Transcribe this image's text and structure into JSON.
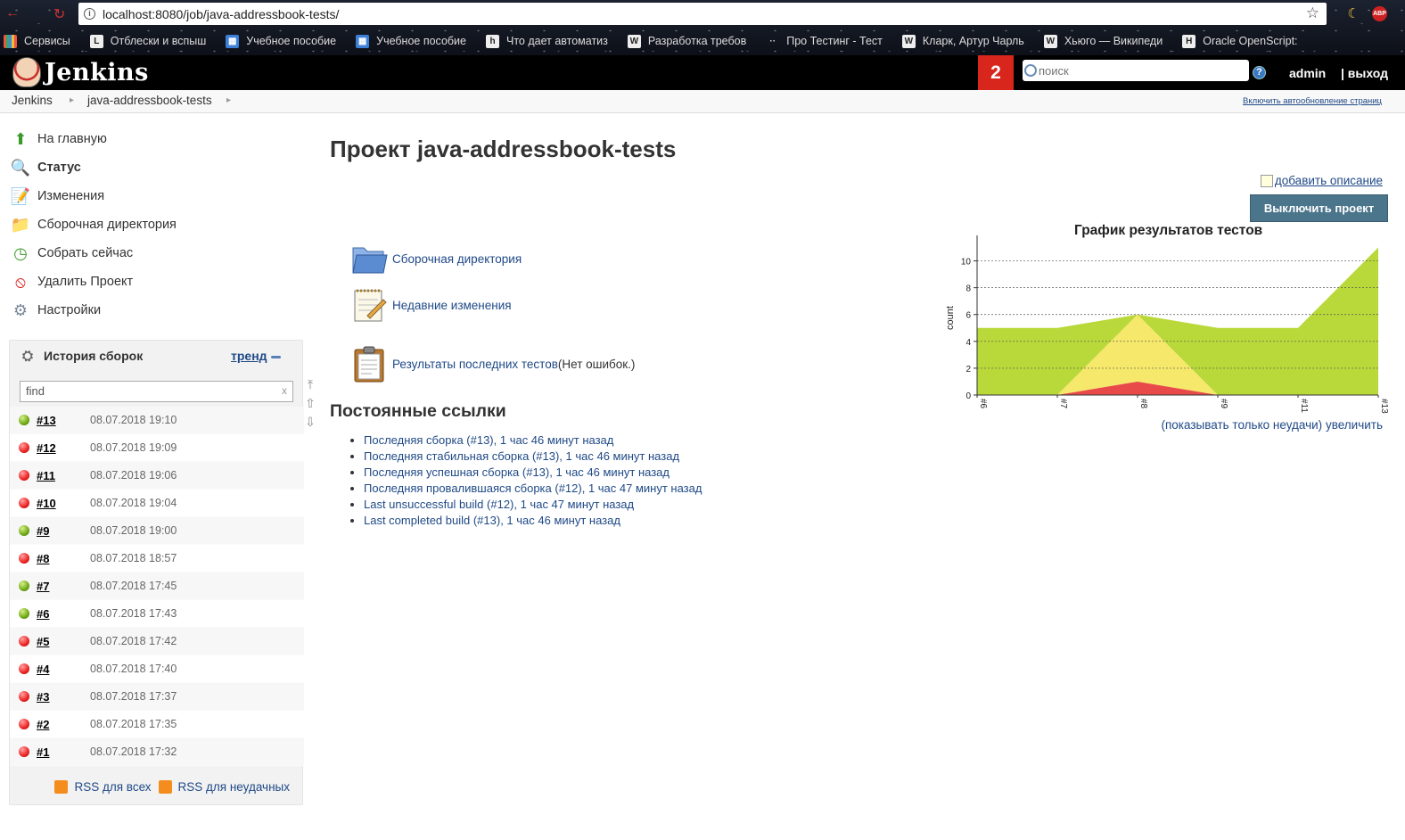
{
  "browser": {
    "url": "localhost:8080/job/java-addressbook-tests/",
    "bookmarks": [
      "Сервисы",
      "Отблески и вспыш",
      "Учебное пособие",
      "Учебное пособие",
      "Что дает автоматиз",
      "Разработка требов",
      "Про Тестинг - Тест",
      "Кларк, Артур Чарль",
      "Хьюго — Википеди",
      "Oracle OpenScript:"
    ],
    "abp_label": "ABP"
  },
  "header": {
    "logo_text": "Jenkins",
    "notifications_count": "2",
    "search_placeholder": "поиск",
    "help": "?",
    "user": "admin",
    "logout": "| выход"
  },
  "breadcrumbs": {
    "items": [
      "Jenkins",
      "java-addressbook-tests"
    ],
    "autorefresh": "Включить автообновление страниц"
  },
  "sidebar": {
    "tasks": [
      {
        "label": "На главную",
        "icon": "up-arrow-icon"
      },
      {
        "label": "Статус",
        "icon": "magnifier-icon"
      },
      {
        "label": "Изменения",
        "icon": "notepad-icon"
      },
      {
        "label": "Сборочная директория",
        "icon": "folder-icon"
      },
      {
        "label": "Собрать сейчас",
        "icon": "build-clock-icon"
      },
      {
        "label": "Удалить Проект",
        "icon": "no-entry-icon"
      },
      {
        "label": "Настройки",
        "icon": "gear-icon"
      }
    ],
    "history": {
      "title": "История сборок",
      "trend": "тренд",
      "find_value": "find",
      "clear": "x",
      "builds": [
        {
          "num": "#13",
          "date": "08.07.2018 19:10",
          "status": "green"
        },
        {
          "num": "#12",
          "date": "08.07.2018 19:09",
          "status": "red"
        },
        {
          "num": "#11",
          "date": "08.07.2018 19:06",
          "status": "red"
        },
        {
          "num": "#10",
          "date": "08.07.2018 19:04",
          "status": "red"
        },
        {
          "num": "#9",
          "date": "08.07.2018 19:00",
          "status": "green"
        },
        {
          "num": "#8",
          "date": "08.07.2018 18:57",
          "status": "red"
        },
        {
          "num": "#7",
          "date": "08.07.2018 17:45",
          "status": "green"
        },
        {
          "num": "#6",
          "date": "08.07.2018 17:43",
          "status": "green"
        },
        {
          "num": "#5",
          "date": "08.07.2018 17:42",
          "status": "red"
        },
        {
          "num": "#4",
          "date": "08.07.2018 17:40",
          "status": "red"
        },
        {
          "num": "#3",
          "date": "08.07.2018 17:37",
          "status": "red"
        },
        {
          "num": "#2",
          "date": "08.07.2018 17:35",
          "status": "red"
        },
        {
          "num": "#1",
          "date": "08.07.2018 17:32",
          "status": "red"
        }
      ],
      "rss_all": "RSS для всех",
      "rss_failed": "RSS для неудачных"
    }
  },
  "main": {
    "title": "Проект java-addressbook-tests",
    "add_description": "добавить описание",
    "disable_button": "Выключить проект",
    "links": [
      {
        "label": "Сборочная директория",
        "suffix": "",
        "icon": "folder-icon"
      },
      {
        "label": "Недавние изменения",
        "suffix": "",
        "icon": "notepad-icon"
      },
      {
        "label": "Результаты последних тестов",
        "suffix": " (Нет ошибок.)",
        "icon": "clipboard-icon"
      }
    ],
    "permalinks_title": "Постоянные ссылки",
    "permalinks": [
      "Последняя сборка (#13), 1 час 46 минут назад",
      "Последняя стабильная сборка (#13), 1 час 46 минут назад",
      "Последняя успешная сборка (#13), 1 час 46 минут назад",
      "Последняя провалившаяся сборка (#12), 1 час 47 минут назад",
      "Last unsuccessful build (#12), 1 час 47 минут назад",
      "Last completed build (#13), 1 час 46 минут назад"
    ],
    "chart_links": {
      "failures_only": "(показывать только неудачи)",
      "enlarge": "увеличить"
    }
  },
  "chart_data": {
    "type": "area",
    "title": "График результатов тестов",
    "ylabel": "count",
    "categories": [
      "#6",
      "#7",
      "#8",
      "#9",
      "#11",
      "#13"
    ],
    "y_ticks": [
      0,
      2,
      4,
      6,
      8,
      10
    ],
    "ylim": [
      0,
      11.5
    ],
    "grid": true,
    "series": [
      {
        "color": "#e84a4a",
        "values": [
          0,
          0,
          1,
          0,
          0,
          0
        ]
      },
      {
        "color": "#f5e86a",
        "values": [
          0,
          0,
          5,
          0,
          0,
          0
        ]
      },
      {
        "color": "#b9d83a",
        "values": [
          5,
          5,
          0,
          5,
          5,
          11
        ]
      }
    ]
  }
}
